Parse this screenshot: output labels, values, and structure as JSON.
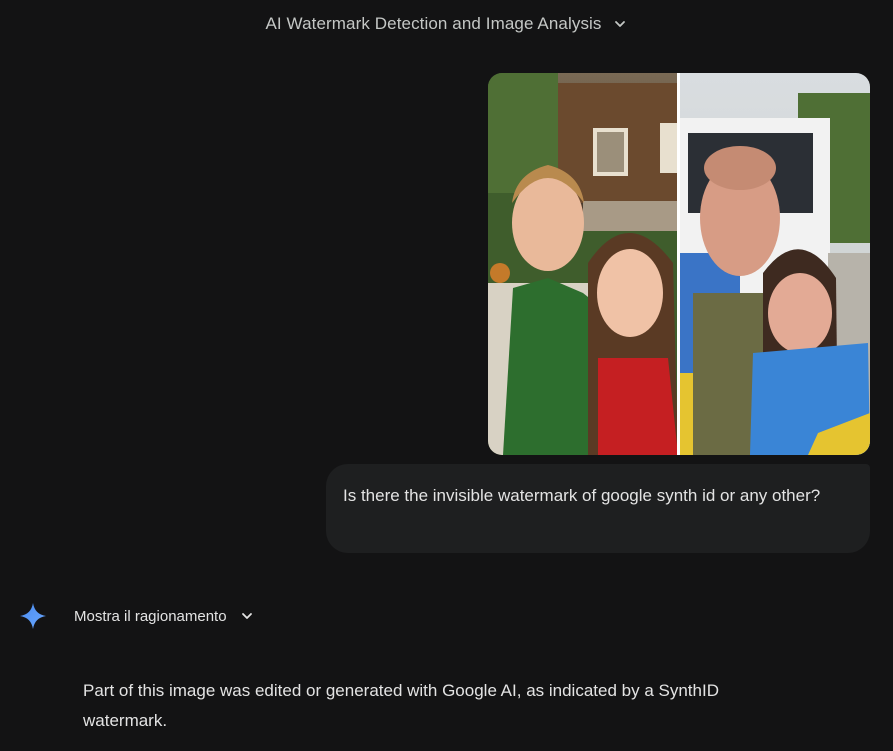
{
  "conversation": {
    "title": "AI Watermark Detection and Image Analysis"
  },
  "user_message": {
    "image_icon": "photo-collage",
    "text": "Is there the invisible watermark of google synth id or any other?"
  },
  "gemini": {
    "icon": "gemini-spark-icon",
    "reasoning_toggle_label": "Mostra il ragionamento",
    "answer_text": "Part of this image was edited or generated with Google AI, as indicated by a SynthID watermark."
  },
  "colors": {
    "background": "#131314",
    "bubble": "#1e1f20",
    "text": "#e3e3e3",
    "spark_blue": "#4a8cf0"
  }
}
